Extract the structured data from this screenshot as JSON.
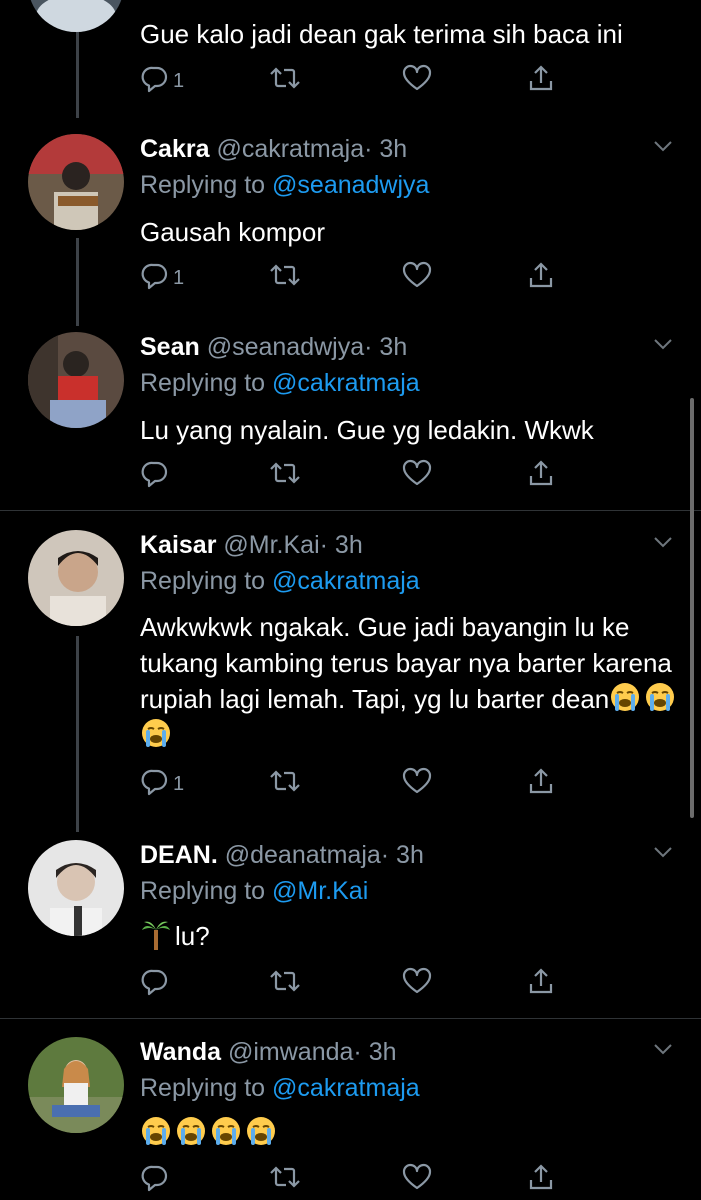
{
  "top_tweet": {
    "text": "Gue kalo jadi dean gak terima sih baca ini",
    "reply_count": "1"
  },
  "tweets": [
    {
      "name": "Cakra",
      "handle": "@cakratmaja",
      "time": "· 3h",
      "replying_prefix": "Replying to ",
      "replying_to": "@seanadwjya",
      "text": "Gausah kompor",
      "reply_count": "1"
    },
    {
      "name": "Sean",
      "handle": "@seanadwjya",
      "time": "· 3h",
      "replying_prefix": "Replying to ",
      "replying_to": "@cakratmaja",
      "text": "Lu yang nyalain. Gue yg ledakin. Wkwk",
      "reply_count": ""
    },
    {
      "name": "Kaisar",
      "handle": "@Mr.Kai",
      "time": "· 3h",
      "replying_prefix": "Replying to ",
      "replying_to": "@cakratmaja",
      "text": "Awkwkwk ngakak. Gue jadi bayangin lu ke tukang kambing terus bayar nya barter karena rupiah lagi lemah. Tapi, yg lu barter dean",
      "text_emoji": [
        "loudly-crying-face",
        "loudly-crying-face",
        "loudly-crying-face"
      ],
      "reply_count": "1"
    },
    {
      "name": "DEAN.",
      "handle": "@deanatmaja",
      "time": "· 3h",
      "replying_prefix": "Replying to ",
      "replying_to": "@Mr.Kai",
      "text_emoji_prefix": "palm-tree",
      "text": "lu?",
      "reply_count": ""
    },
    {
      "name": "Wanda",
      "handle": "@imwanda",
      "time": "· 3h",
      "replying_prefix": "Replying to ",
      "replying_to": "@cakratmaja",
      "text": "",
      "text_emoji": [
        "loudly-crying-face",
        "loudly-crying-face",
        "loudly-crying-face",
        "loudly-crying-face"
      ],
      "reply_count": ""
    }
  ],
  "icons": {
    "reply": "reply-icon",
    "retweet": "retweet-icon",
    "like": "heart-icon",
    "share": "share-icon",
    "more": "chevron-down-icon"
  },
  "colors": {
    "background": "#000000",
    "secondary_text": "#8b98a5",
    "mention": "#1d9bf0",
    "divider": "#2f3336"
  }
}
